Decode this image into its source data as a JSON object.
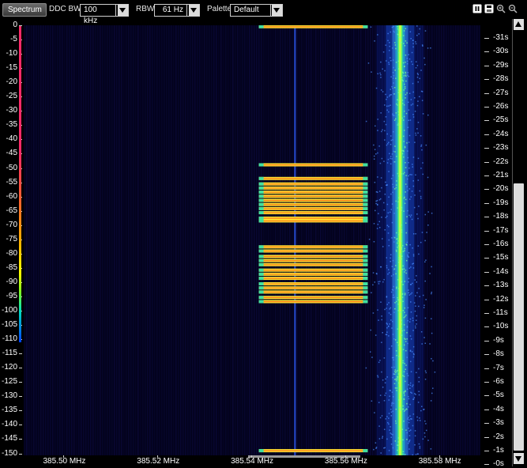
{
  "toolbar": {
    "spectrum_label": "Spectrum",
    "ddc_bw_label": "DDC BW",
    "ddc_bw_value": "100 kHz",
    "rbw_label": "RBW",
    "rbw_value": "61 Hz",
    "palette_label": "Palette",
    "palette_value": "Default",
    "icons": [
      "pause-icon",
      "save-icon",
      "zoom-in-icon",
      "zoom-out-icon"
    ]
  },
  "colors": {
    "background": "#000000",
    "waterfall_bg": "#03021c",
    "accent": "#ffff00"
  },
  "y_axis": {
    "unit": "dB",
    "labels": [
      "0",
      "-5",
      "-10",
      "-15",
      "-20",
      "-25",
      "-30",
      "-35",
      "-40",
      "-45",
      "-50",
      "-55",
      "-60",
      "-65",
      "-70",
      "-75",
      "-80",
      "-85",
      "-90",
      "-95",
      "-100",
      "-105",
      "-110",
      "-115",
      "-120",
      "-125",
      "-130",
      "-135",
      "-140",
      "-145",
      "-150"
    ]
  },
  "time_axis": {
    "labels": [
      "-31s",
      "-30s",
      "-29s",
      "-28s",
      "-27s",
      "-26s",
      "-25s",
      "-24s",
      "-23s",
      "-22s",
      "-21s",
      "-20s",
      "-19s",
      "-18s",
      "-17s",
      "-16s",
      "-15s",
      "-14s",
      "-13s",
      "-12s",
      "-11s",
      "-10s",
      "-9s",
      "-8s",
      "-7s",
      "-6s",
      "-5s",
      "-4s",
      "-3s",
      "-2s",
      "-1s",
      "-0s"
    ]
  },
  "freq_axis": {
    "labels": [
      "385.50 MHz",
      "385.52 MHz",
      "385.54 MHz",
      "385.56 MHz",
      "385.58 MHz"
    ],
    "values_mhz": [
      385.5,
      385.52,
      385.54,
      385.56,
      385.58
    ],
    "range_mhz": [
      385.4915,
      385.5888
    ]
  },
  "chart_data": {
    "type": "heatmap",
    "x_range_mhz": [
      385.4915,
      385.5888
    ],
    "time_range_s": [
      -31.5,
      0
    ],
    "signals": [
      {
        "name": "continuous-carrier",
        "freq_mhz": 385.5717,
        "width_mhz": 0.0012,
        "start_s": -31.5,
        "end_s": 0,
        "level": "high"
      },
      {
        "name": "weak-spur",
        "freq_mhz": 385.5493,
        "width_mhz": 0.0002,
        "start_s": -31.5,
        "end_s": 0,
        "level": "low"
      }
    ],
    "bursts": {
      "freq_range_mhz": [
        385.5416,
        385.5648
      ],
      "times_s": [
        -31.4,
        -21.3,
        -20.3,
        -19.9,
        -19.6,
        -19.3,
        -19.0,
        -18.7,
        -18.4,
        -18.1,
        -17.8,
        -17.4,
        -17.2,
        -15.3,
        -15.0,
        -14.6,
        -14.3,
        -14.0,
        -13.6,
        -13.3,
        -13.0,
        -12.6,
        -12.3,
        -12.0,
        -11.6,
        -11.3,
        -0.4
      ]
    },
    "grid": false
  }
}
